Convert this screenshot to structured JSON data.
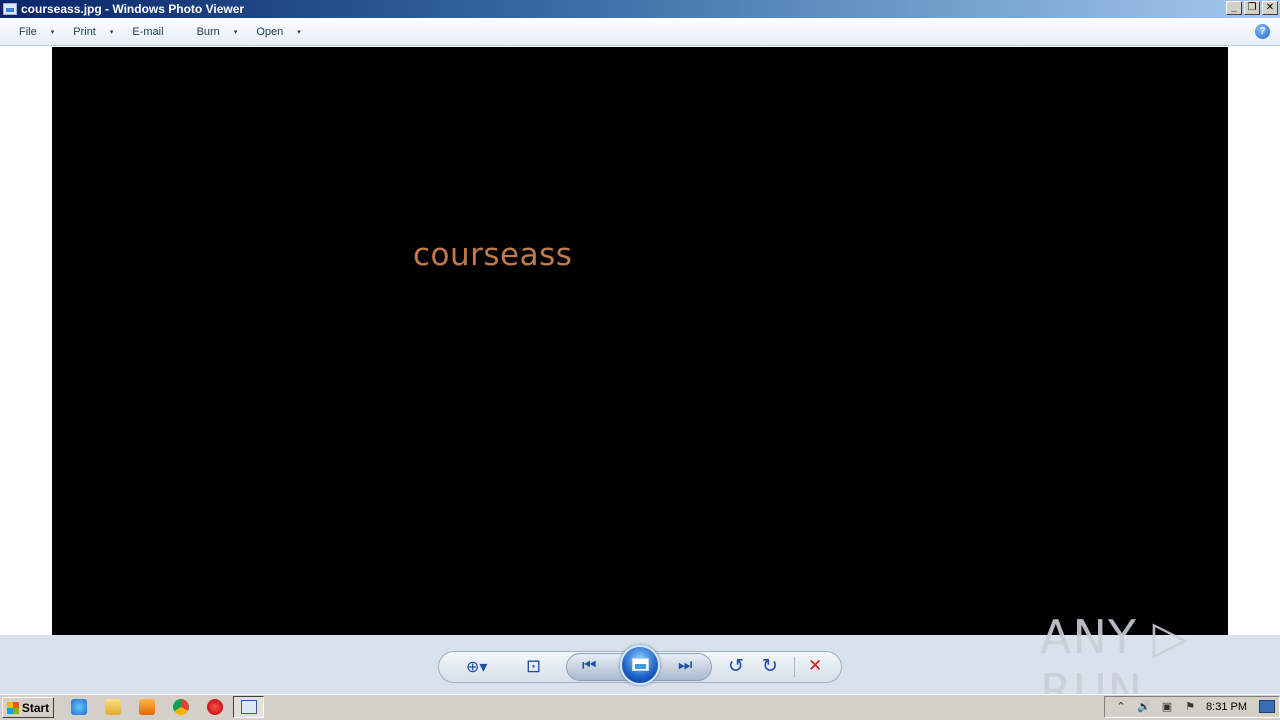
{
  "window": {
    "title": "courseass.jpg - Windows Photo Viewer",
    "buttons": {
      "minimize": "_",
      "restore": "❐",
      "close": "✕"
    }
  },
  "menu": {
    "items": [
      {
        "label": "File",
        "has_dropdown": true
      },
      {
        "label": "Print",
        "has_dropdown": true
      },
      {
        "label": "E-mail",
        "has_dropdown": false
      },
      {
        "label": "Burn",
        "has_dropdown": true
      },
      {
        "label": "Open",
        "has_dropdown": true
      }
    ],
    "dropdown_glyph": "▾",
    "help_glyph": "?"
  },
  "photo": {
    "text": "courseass",
    "text_color": "#c27a4a",
    "background": "#000000"
  },
  "controls": {
    "zoom_icon": "zoom-icon",
    "fit_icon": "actual-size-icon",
    "previous_icon": "previous-icon",
    "slideshow_icon": "slideshow-icon",
    "next_icon": "next-icon",
    "rotate_ccw_icon": "rotate-counterclockwise-icon",
    "rotate_cw_icon": "rotate-clockwise-icon",
    "delete_icon": "delete-icon",
    "glyphs": {
      "zoom": "⊕▾",
      "fit": "⊡",
      "previous": "⏮",
      "next": "⏭",
      "rotate_ccw": "↺",
      "rotate_cw": "↻",
      "delete": "✕"
    }
  },
  "watermark": "ANY ▷ RUN",
  "taskbar": {
    "start_label": "Start",
    "clock": "8:31 PM",
    "tray_glyphs": {
      "expand": "⌃",
      "volume": "🔊",
      "network": "▣",
      "flag": "⚑"
    }
  }
}
